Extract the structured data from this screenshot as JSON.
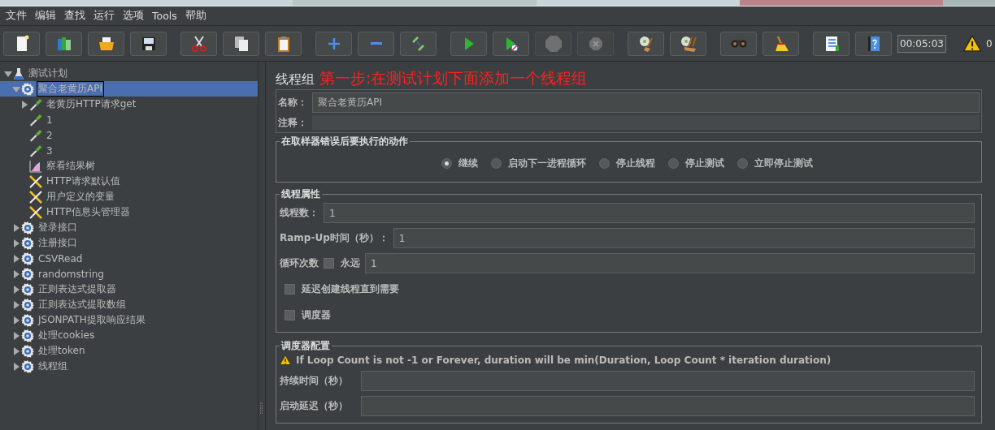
{
  "menu": [
    "文件",
    "编辑",
    "查找",
    "运行",
    "选项",
    "Tools",
    "帮助"
  ],
  "toolbar": [
    [
      {
        "kind": "new",
        "disabled": false
      },
      {
        "kind": "templates",
        "disabled": false
      },
      {
        "kind": "open",
        "disabled": false
      },
      {
        "kind": "save",
        "disabled": false
      }
    ],
    [
      {
        "kind": "cut",
        "disabled": false
      },
      {
        "kind": "copy",
        "disabled": false
      },
      {
        "kind": "paste",
        "disabled": false
      }
    ],
    [
      {
        "kind": "add",
        "disabled": false
      },
      {
        "kind": "remove",
        "disabled": false
      },
      {
        "kind": "toggle",
        "disabled": false
      }
    ],
    [
      {
        "kind": "start",
        "disabled": false
      },
      {
        "kind": "start_no_timers",
        "disabled": false
      },
      {
        "kind": "stop",
        "disabled": true
      },
      {
        "kind": "shutdown",
        "disabled": true
      }
    ],
    [
      {
        "kind": "clear",
        "disabled": false
      },
      {
        "kind": "clear_all",
        "disabled": false
      }
    ],
    [
      {
        "kind": "search",
        "disabled": false
      },
      {
        "kind": "reset_search",
        "disabled": false
      }
    ],
    [
      {
        "kind": "functions",
        "disabled": false
      },
      {
        "kind": "help",
        "disabled": false
      }
    ]
  ],
  "timer": "00:05:03",
  "warning_count": "0",
  "tree": [
    {
      "label": "测试计划",
      "kind": "plan",
      "expanded": true,
      "selected": false,
      "children": [
        {
          "label": "聚合老黄历API",
          "kind": "thread_group",
          "expanded": true,
          "selected": true,
          "children": [
            {
              "label": "老黄历HTTP请求get",
              "kind": "sampler",
              "expanded": false,
              "selected": false
            },
            {
              "label": "1",
              "kind": "sampler",
              "selected": false
            },
            {
              "label": "2",
              "kind": "sampler",
              "selected": false
            },
            {
              "label": "3",
              "kind": "sampler",
              "selected": false
            },
            {
              "label": "察看结果树",
              "kind": "listener",
              "selected": false
            },
            {
              "label": "HTTP请求默认值",
              "kind": "config",
              "selected": false
            },
            {
              "label": "用户定义的变量",
              "kind": "config",
              "selected": false
            },
            {
              "label": "HTTP信息头管理器",
              "kind": "config",
              "selected": false
            }
          ]
        },
        {
          "label": "登录接口",
          "kind": "thread_group",
          "expanded": false,
          "selected": false
        },
        {
          "label": "注册接口",
          "kind": "thread_group",
          "expanded": false,
          "selected": false
        },
        {
          "label": "CSVRead",
          "kind": "thread_group",
          "expanded": false,
          "selected": false
        },
        {
          "label": "randomstring",
          "kind": "thread_group",
          "expanded": false,
          "selected": false
        },
        {
          "label": "正则表达式提取器",
          "kind": "thread_group",
          "expanded": false,
          "selected": false
        },
        {
          "label": "正则表达式提取数组",
          "kind": "thread_group",
          "expanded": false,
          "selected": false
        },
        {
          "label": "JSONPATH提取响应结果",
          "kind": "thread_group",
          "expanded": false,
          "selected": false
        },
        {
          "label": "处理cookies",
          "kind": "thread_group",
          "expanded": false,
          "selected": false
        },
        {
          "label": "处理token",
          "kind": "thread_group",
          "expanded": false,
          "selected": false
        },
        {
          "label": "线程组",
          "kind": "thread_group",
          "expanded": false,
          "selected": false
        }
      ]
    }
  ],
  "panel": {
    "title": "线程组",
    "annotation": "第一步:在测试计划下面添加一个线程组",
    "name": {
      "label": "名称：",
      "value": "聚合老黄历API"
    },
    "comment": {
      "label": "注释："
    },
    "error_action": {
      "title": "在取样器错误后要执行的动作",
      "options": [
        {
          "label": "继续",
          "selected": true
        },
        {
          "label": "启动下一进程循环",
          "selected": false
        },
        {
          "label": "停止线程",
          "selected": false
        },
        {
          "label": "停止测试",
          "selected": false
        },
        {
          "label": "立即停止测试",
          "selected": false
        }
      ]
    },
    "thread_properties": {
      "title": "线程属性",
      "threads": {
        "label": "线程数：",
        "value": "1"
      },
      "ramp_up": {
        "label": "Ramp-Up时间（秒）：",
        "value": "1"
      },
      "loop": {
        "label": "循环次数",
        "forever_label": "永远",
        "forever_checked": false,
        "value": "1"
      },
      "options": [
        {
          "label": "延迟创建线程直到需要",
          "checked": false
        },
        {
          "label": "调度器",
          "checked": false
        }
      ]
    },
    "scheduler": {
      "title": "调度器配置",
      "warning": "If Loop Count is not -1 or Forever, duration will be min(Duration, Loop Count * iteration duration)",
      "fields": [
        {
          "label": "持续时间（秒）"
        },
        {
          "label": "启动延迟（秒）"
        }
      ]
    }
  }
}
